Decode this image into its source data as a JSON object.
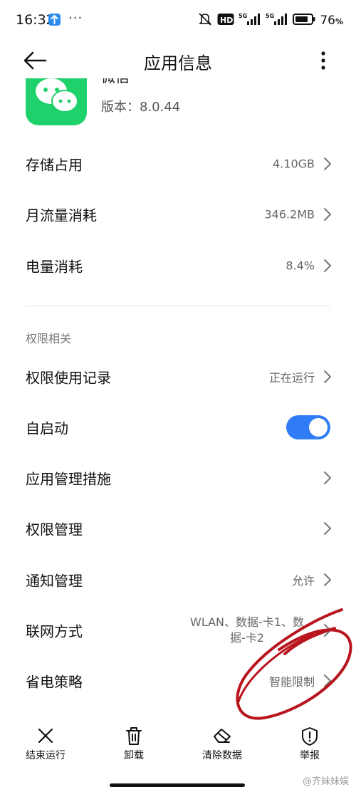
{
  "status_bar": {
    "time": "16:32",
    "more_dots": "···",
    "battery_level": "76",
    "battery_unit": "%",
    "network_badges": [
      "HD",
      "5G",
      "5G"
    ],
    "icons": [
      "upload-badge-icon",
      "mute-icon",
      "signal-icon",
      "battery-icon"
    ]
  },
  "app_bar": {
    "title": "应用信息",
    "back_icon": "back-arrow-icon",
    "menu_icon": "more-vertical-icon"
  },
  "app": {
    "name": "微信",
    "version": "版本：8.0.44",
    "icon_color": "#1fd16a"
  },
  "rows_top": [
    {
      "label": "存储占用",
      "value": "4.10GB"
    },
    {
      "label": "月流量消耗",
      "value": "346.2MB"
    },
    {
      "label": "电量消耗",
      "value": "8.4%"
    }
  ],
  "section": {
    "title": "权限相关"
  },
  "rows_perm": [
    {
      "label": "权限使用记录",
      "value": "正在运行"
    },
    {
      "label": "自启动",
      "toggle_on": true
    },
    {
      "label": "应用管理措施",
      "value": ""
    },
    {
      "label": "权限管理",
      "value": ""
    },
    {
      "label": "通知管理",
      "value": "允许"
    },
    {
      "label": "联网方式",
      "value_line1": "WLAN、数据-卡1、数",
      "value_line2": "据-卡2"
    },
    {
      "label": "省电策略",
      "value": "智能限制"
    }
  ],
  "bottom_bar": [
    {
      "label": "结束运行",
      "icon": "close-icon"
    },
    {
      "label": "卸载",
      "icon": "trash-icon"
    },
    {
      "label": "清除数据",
      "icon": "eraser-icon"
    },
    {
      "label": "举报",
      "icon": "shield-alert-icon"
    }
  ],
  "watermark": "@齐妹妹娱",
  "colors": {
    "accent": "#2f7cf6",
    "annotation": "#b8141e",
    "app_green": "#1fd16a"
  }
}
